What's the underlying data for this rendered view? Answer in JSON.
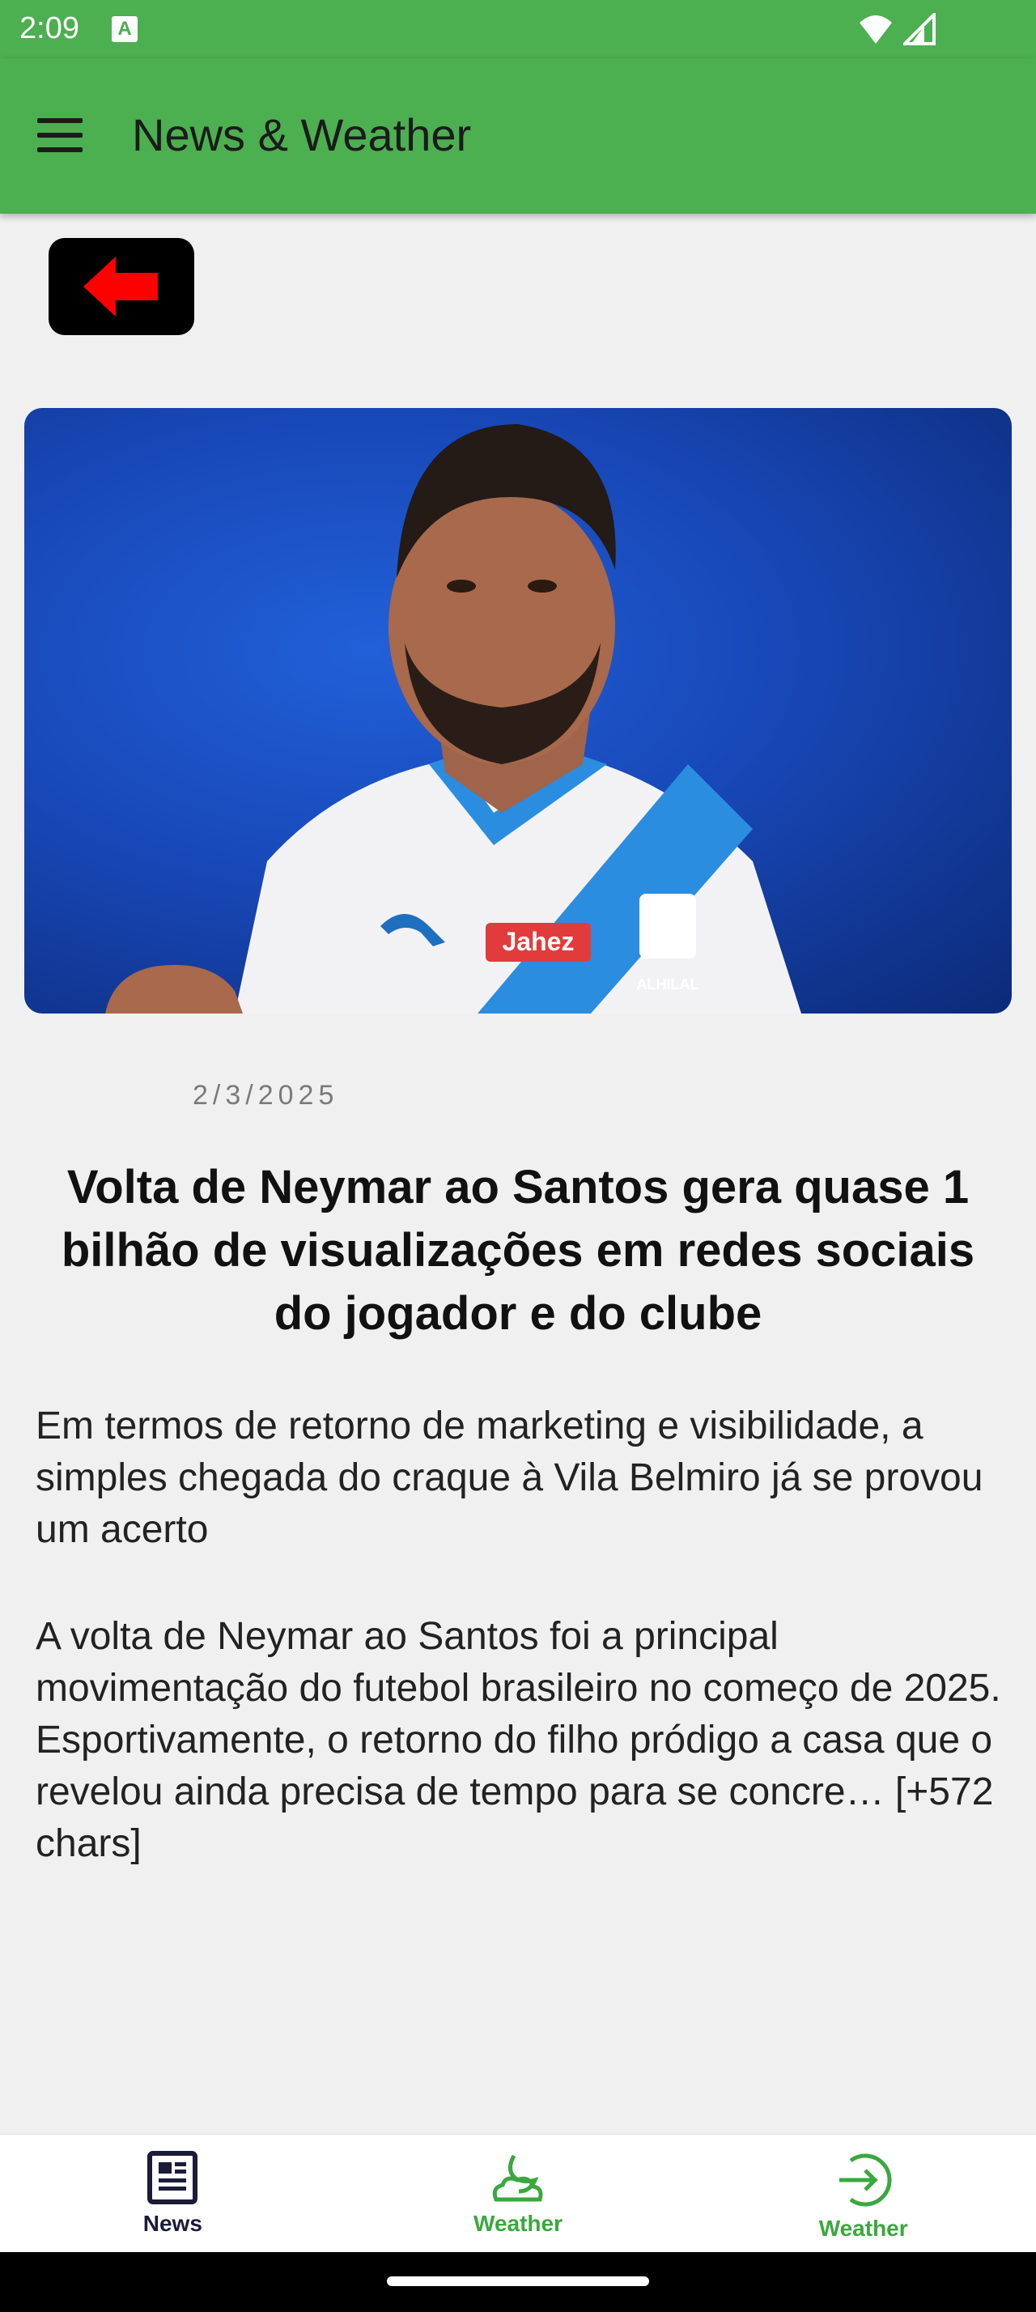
{
  "status_bar": {
    "time": "2:09",
    "notification_badge": "A",
    "icons": [
      "wifi-icon",
      "signal-icon"
    ]
  },
  "app_bar": {
    "title": "News & Weather",
    "menu_icon": "hamburger-menu-icon"
  },
  "back_button": {
    "icon": "red-left-arrow-icon"
  },
  "article": {
    "image_badge_text": "Jahez",
    "image_crest_text": "ALHILAL",
    "date": "2/3/2025",
    "headline": "Volta de Neymar ao Santos gera quase 1 bilhão de visualizações em redes sociais do jogador e do clube",
    "subtitle": "Em termos de retorno de marketing e visibilidade, a simples chegada do craque à Vila Belmiro já se provou um acerto",
    "body": "A volta de Neymar ao Santos foi a principal movimentação do futebol brasileiro no começo de 2025. Esportivamente, o retorno do filho pródigo a casa que o revelou ainda precisa de tempo para se concre… [+572 chars]"
  },
  "bottom_nav": {
    "items": [
      {
        "label": "News",
        "icon": "newspaper-icon"
      },
      {
        "label": "Weather",
        "icon": "cloud-moon-icon"
      },
      {
        "label": "Weather",
        "icon": "arrow-login-icon"
      }
    ]
  },
  "colors": {
    "primary": "#4caf50",
    "nav_active_green": "#3aa83e",
    "back_arrow": "#ff0000"
  }
}
